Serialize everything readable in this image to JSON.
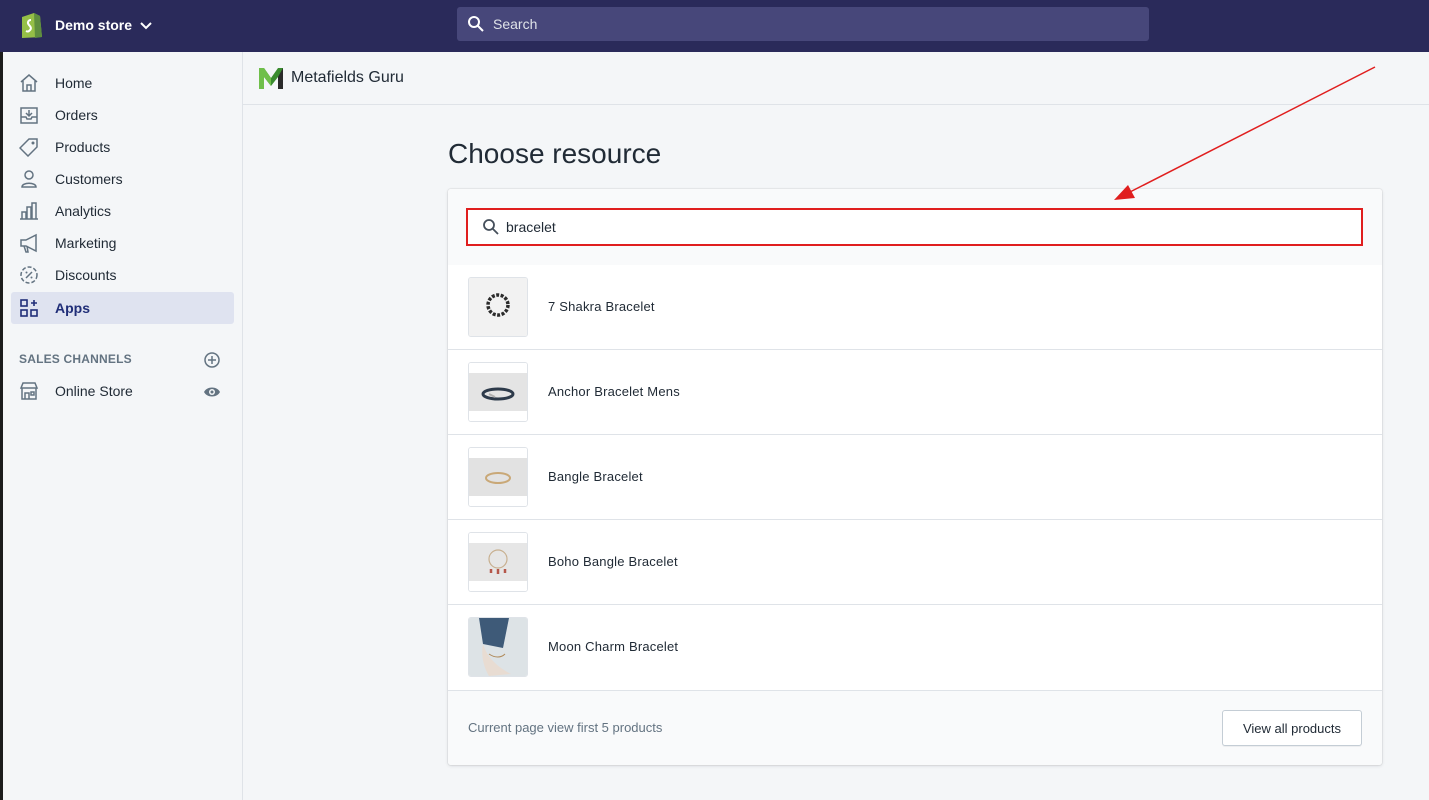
{
  "topbar": {
    "store_name": "Demo store",
    "search_placeholder": "Search"
  },
  "sidebar": {
    "items": [
      {
        "label": "Home",
        "icon": "home-icon"
      },
      {
        "label": "Orders",
        "icon": "orders-icon"
      },
      {
        "label": "Products",
        "icon": "tag-icon"
      },
      {
        "label": "Customers",
        "icon": "person-icon"
      },
      {
        "label": "Analytics",
        "icon": "bar-chart-icon"
      },
      {
        "label": "Marketing",
        "icon": "megaphone-icon"
      },
      {
        "label": "Discounts",
        "icon": "discount-icon"
      },
      {
        "label": "Apps",
        "icon": "apps-icon",
        "active": true
      }
    ],
    "sales_channels_title": "SALES CHANNELS",
    "channels": [
      {
        "label": "Online Store",
        "icon": "store-icon"
      }
    ]
  },
  "app": {
    "name": "Metafields Guru"
  },
  "main": {
    "title": "Choose resource",
    "filter_value": "bracelet",
    "products": [
      {
        "title": "7 Shakra Bracelet"
      },
      {
        "title": "Anchor Bracelet Mens"
      },
      {
        "title": "Bangle Bracelet"
      },
      {
        "title": "Boho Bangle Bracelet"
      },
      {
        "title": "Moon Charm Bracelet"
      }
    ],
    "footer_text": "Current page view first 5 products",
    "view_all_label": "View all products"
  },
  "colors": {
    "topbar": "#2a2a5a",
    "highlight": "#e01e1e",
    "active_nav": "#202e78"
  }
}
